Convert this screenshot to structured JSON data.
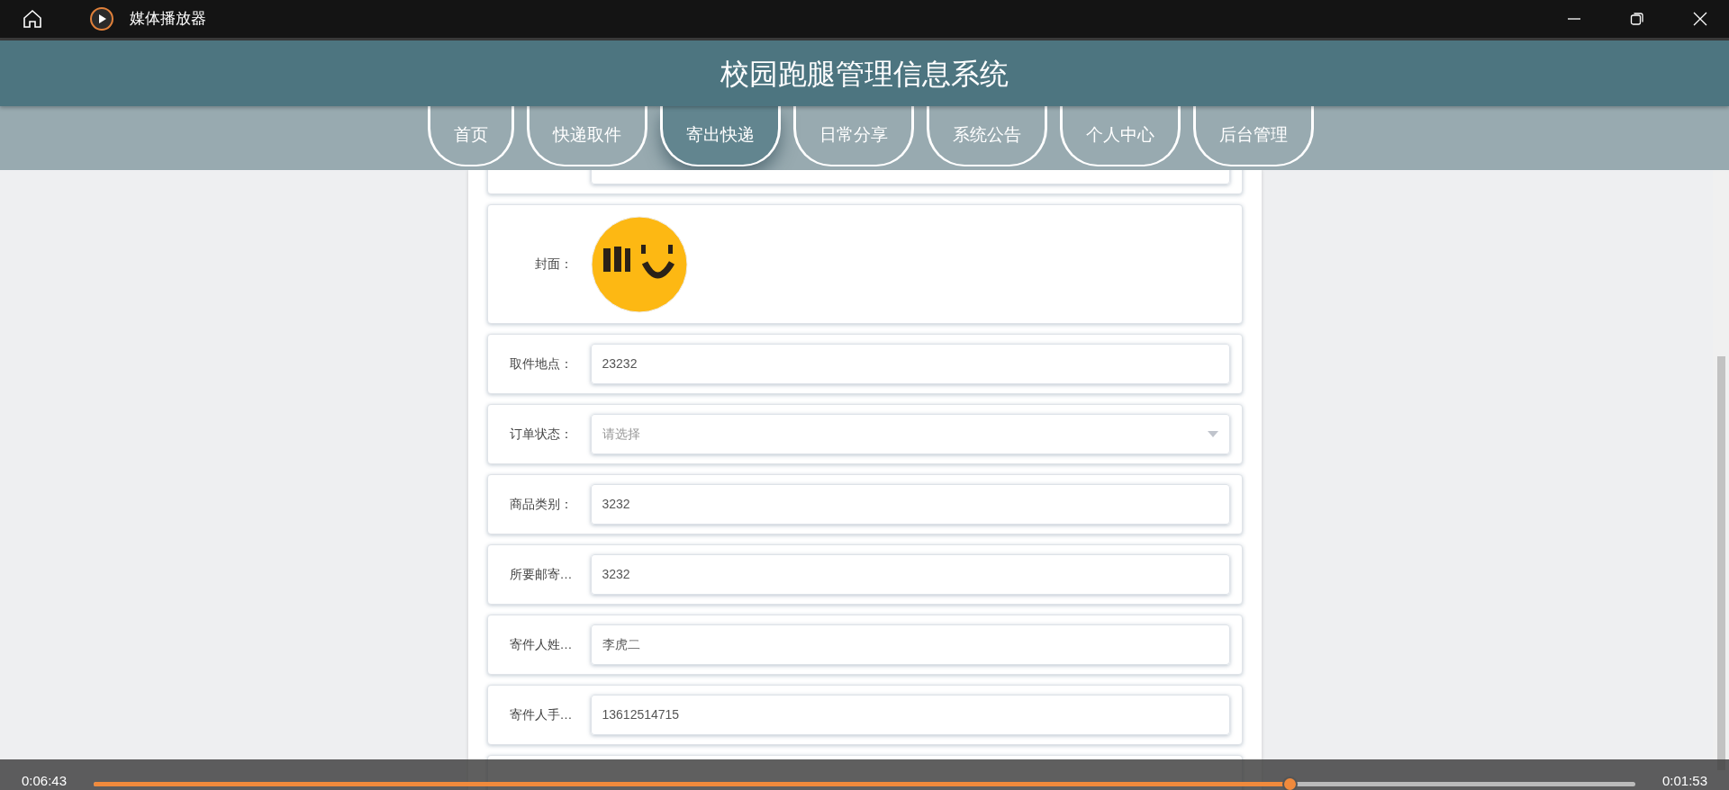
{
  "window": {
    "title": "媒体播放器"
  },
  "site": {
    "title": "校园跑腿管理信息系统"
  },
  "nav": [
    {
      "label": "首页",
      "selected": false
    },
    {
      "label": "快递取件",
      "selected": false
    },
    {
      "label": "寄出快递",
      "selected": true
    },
    {
      "label": "日常分享",
      "selected": false
    },
    {
      "label": "系统公告",
      "selected": false
    },
    {
      "label": "个人中心",
      "selected": false
    },
    {
      "label": "后台管理",
      "selected": false
    }
  ],
  "form": {
    "rows": [
      {
        "kind": "image",
        "label": "封面："
      },
      {
        "kind": "input",
        "label": "取件地点：",
        "value": "23232"
      },
      {
        "kind": "select",
        "label": "订单状态：",
        "placeholder": "请选择"
      },
      {
        "kind": "input",
        "label": "商品类别：",
        "value": "3232"
      },
      {
        "kind": "input",
        "label": "所要邮寄…",
        "value": "3232"
      },
      {
        "kind": "input",
        "label": "寄件人姓…",
        "value": "李虎二"
      },
      {
        "kind": "input",
        "label": "寄件人手…",
        "value": "13612514715"
      }
    ]
  },
  "player": {
    "elapsed": "0:06:43",
    "remaining": "0:01:53",
    "level": 0.776
  }
}
